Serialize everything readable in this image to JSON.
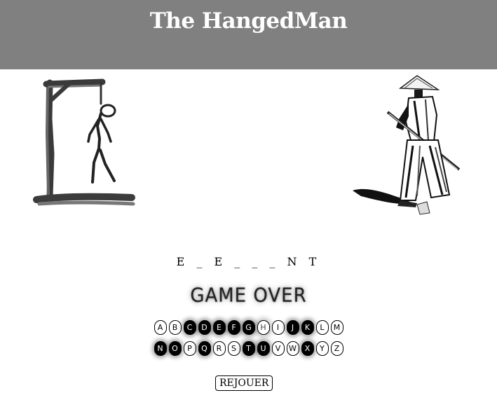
{
  "header": {
    "title": "The HangedMan",
    "bg_color": "#808080"
  },
  "game": {
    "word_display": "E _ E _ _ _ N T",
    "status": "GAME OVER",
    "keyboard": {
      "row1": [
        {
          "letter": "A",
          "state": "available"
        },
        {
          "letter": "B",
          "state": "available"
        },
        {
          "letter": "C",
          "state": "used"
        },
        {
          "letter": "D",
          "state": "used"
        },
        {
          "letter": "E",
          "state": "used"
        },
        {
          "letter": "F",
          "state": "used"
        },
        {
          "letter": "G",
          "state": "used"
        },
        {
          "letter": "H",
          "state": "wrong"
        },
        {
          "letter": "I",
          "state": "available"
        },
        {
          "letter": "J",
          "state": "used"
        },
        {
          "letter": "K",
          "state": "used"
        },
        {
          "letter": "L",
          "state": "available"
        },
        {
          "letter": "M",
          "state": "available"
        }
      ],
      "row2": [
        {
          "letter": "N",
          "state": "used"
        },
        {
          "letter": "O",
          "state": "used"
        },
        {
          "letter": "P",
          "state": "available"
        },
        {
          "letter": "Q",
          "state": "used"
        },
        {
          "letter": "R",
          "state": "available"
        },
        {
          "letter": "S",
          "state": "available"
        },
        {
          "letter": "T",
          "state": "used"
        },
        {
          "letter": "U",
          "state": "used"
        },
        {
          "letter": "V",
          "state": "available"
        },
        {
          "letter": "W",
          "state": "available"
        },
        {
          "letter": "X",
          "state": "used"
        },
        {
          "letter": "Y",
          "state": "available"
        },
        {
          "letter": "Z",
          "state": "available"
        }
      ]
    },
    "replay_label": "REJOUER"
  },
  "images": {
    "left": "hanged-man-gallows-icon",
    "right": "samurai-icon"
  }
}
